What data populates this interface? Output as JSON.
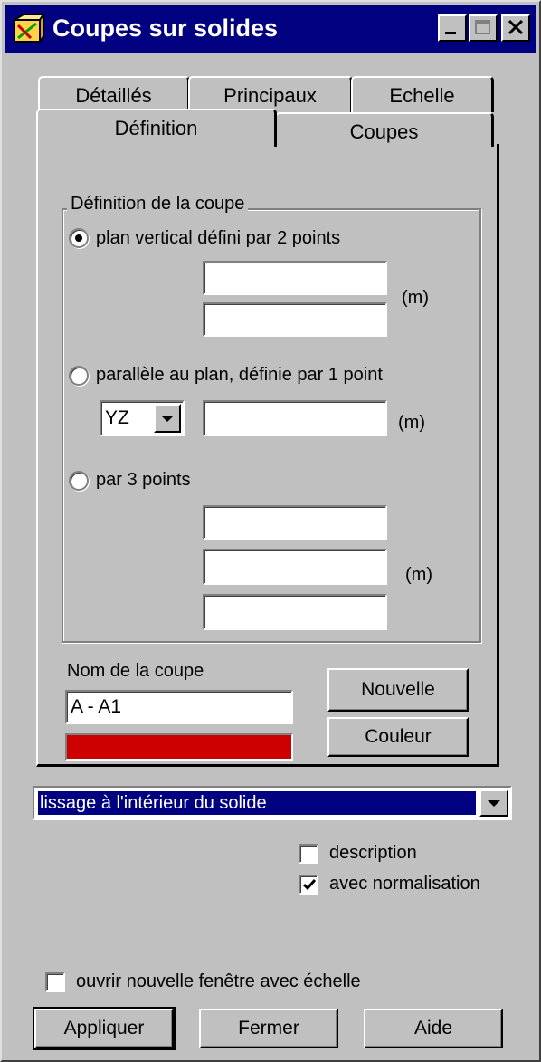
{
  "window": {
    "title": "Coupes sur solides"
  },
  "tabs": {
    "back_row": [
      "Détaillés",
      "Principaux",
      "Echelle"
    ],
    "front_row": [
      "Définition",
      "Coupes"
    ],
    "active": "Définition"
  },
  "definition": {
    "group_title": "Définition de la coupe",
    "option_vertical": "plan vertical défini par 2 points",
    "option_parallel": "parallèle au plan, définie par 1 point",
    "option_three_points": "par 3 points",
    "selected_option": "option_vertical",
    "unit": "(m)",
    "plane_select_value": "YZ",
    "vertical_point1": "",
    "vertical_point2": "",
    "parallel_point": "",
    "three_point1": "",
    "three_point2": "",
    "three_point3": ""
  },
  "section": {
    "name_label": "Nom de la coupe",
    "name_value": "A - A1",
    "color": "#cc0000",
    "new_button": "Nouvelle",
    "color_button": "Couleur"
  },
  "smoothing": {
    "selected": "lissage à l'intérieur du solide"
  },
  "options": {
    "description_label": "description",
    "description_checked": false,
    "normalisation_label": "avec normalisation",
    "normalisation_checked": true,
    "new_window_label": "ouvrir nouvelle fenêtre avec échelle",
    "new_window_checked": false
  },
  "footer": {
    "apply": "Appliquer",
    "close": "Fermer",
    "help": "Aide"
  }
}
